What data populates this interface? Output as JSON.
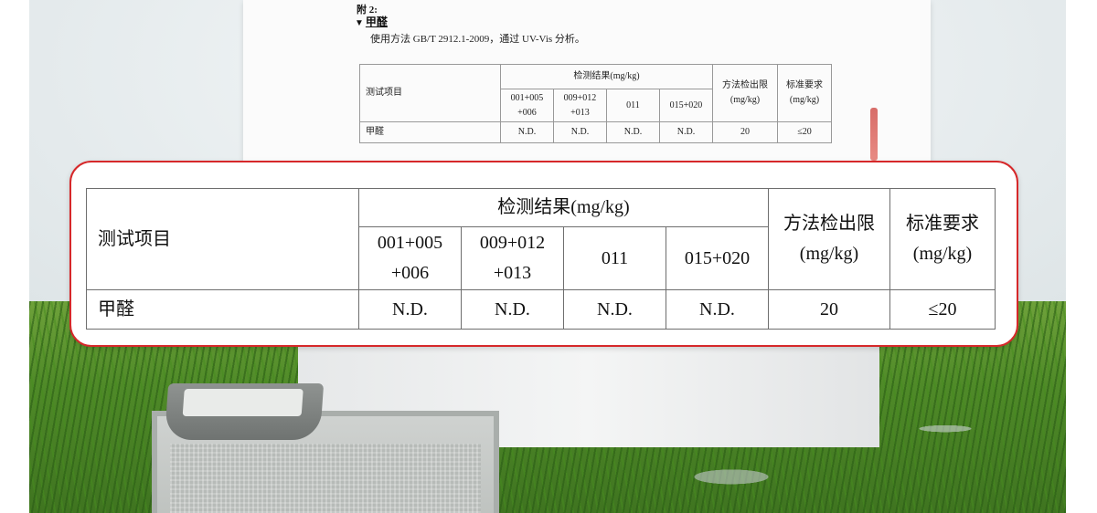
{
  "document": {
    "section_label": "附 2:",
    "item_title": "甲醛",
    "item_marker": "▼",
    "method_text": "使用方法 GB/T 2912.1-2009，通过 UV-Vis 分析。"
  },
  "table": {
    "header": {
      "test_item": "测试项目",
      "result_group": "检测结果(mg/kg)",
      "samples": [
        {
          "line1": "001+005",
          "line2": "+006"
        },
        {
          "line1": "009+012",
          "line2": "+013"
        },
        {
          "line1": "011",
          "line2": ""
        },
        {
          "line1": "015+020",
          "line2": ""
        }
      ],
      "detection_limit": {
        "line1": "方法检出限",
        "line2": "(mg/kg)"
      },
      "standard": {
        "line1": "标准要求",
        "line2": "(mg/kg)"
      }
    },
    "rows": [
      {
        "item": "甲醛",
        "results": [
          "N.D.",
          "N.D.",
          "N.D.",
          "N.D."
        ],
        "detection_limit": "20",
        "standard": "≤20"
      }
    ]
  },
  "colors": {
    "highlight_border": "#d6282a",
    "table_border": "#6e6e6e",
    "grass": "#4f8a28"
  }
}
